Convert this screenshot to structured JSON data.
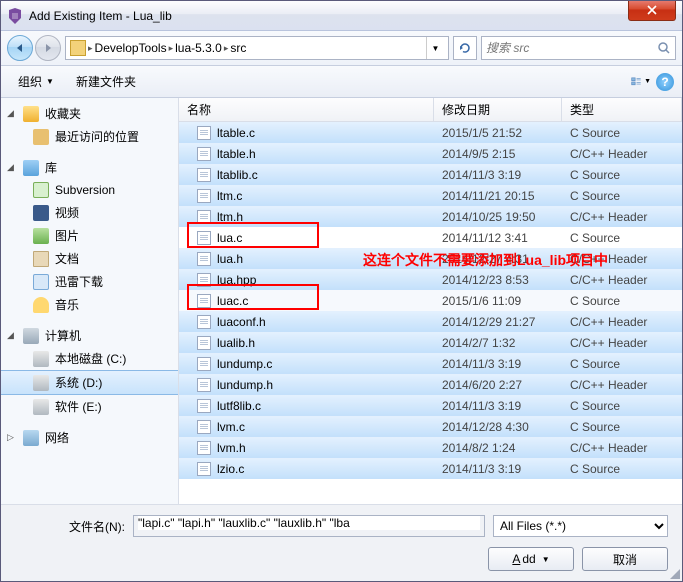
{
  "title": "Add Existing Item - Lua_lib",
  "breadcrumb": {
    "p1": "DevelopTools",
    "p2": "lua-5.3.0",
    "p3": "src"
  },
  "search": {
    "placeholder": "搜索 src"
  },
  "toolbar": {
    "organize": "组织",
    "newfolder": "新建文件夹"
  },
  "sidebar": {
    "fav": "收藏夹",
    "recent": "最近访问的位置",
    "lib": "库",
    "svn": "Subversion",
    "video": "视频",
    "image": "图片",
    "doc": "文档",
    "dl": "迅雷下载",
    "music": "音乐",
    "pc": "计算机",
    "c": "本地磁盘 (C:)",
    "d": "系统 (D:)",
    "e": "软件 (E:)",
    "net": "网络"
  },
  "cols": {
    "name": "名称",
    "date": "修改日期",
    "type": "类型"
  },
  "files": {
    "r0": {
      "n": "ltable.c",
      "d": "2015/1/5 21:52",
      "t": "C Source"
    },
    "r1": {
      "n": "ltable.h",
      "d": "2014/9/5 2:15",
      "t": "C/C++ Header"
    },
    "r2": {
      "n": "ltablib.c",
      "d": "2014/11/3 3:19",
      "t": "C Source"
    },
    "r3": {
      "n": "ltm.c",
      "d": "2014/11/21 20:15",
      "t": "C Source"
    },
    "r4": {
      "n": "ltm.h",
      "d": "2014/10/25 19:50",
      "t": "C/C++ Header"
    },
    "r5": {
      "n": "lua.c",
      "d": "2014/11/12 3:41",
      "t": "C Source"
    },
    "r6": {
      "n": "lua.h",
      "d": "2014/12/27 4:31",
      "t": "C/C++ Header"
    },
    "r7": {
      "n": "lua.hpp",
      "d": "2014/12/23 8:53",
      "t": "C/C++ Header"
    },
    "r8": {
      "n": "luac.c",
      "d": "2015/1/6 11:09",
      "t": "C Source"
    },
    "r9": {
      "n": "luaconf.h",
      "d": "2014/12/29 21:27",
      "t": "C/C++ Header"
    },
    "r10": {
      "n": "lualib.h",
      "d": "2014/2/7 1:32",
      "t": "C/C++ Header"
    },
    "r11": {
      "n": "lundump.c",
      "d": "2014/11/3 3:19",
      "t": "C Source"
    },
    "r12": {
      "n": "lundump.h",
      "d": "2014/6/20 2:27",
      "t": "C/C++ Header"
    },
    "r13": {
      "n": "lutf8lib.c",
      "d": "2014/11/3 3:19",
      "t": "C Source"
    },
    "r14": {
      "n": "lvm.c",
      "d": "2014/12/28 4:30",
      "t": "C Source"
    },
    "r15": {
      "n": "lvm.h",
      "d": "2014/8/2 1:24",
      "t": "C/C++ Header"
    },
    "r16": {
      "n": "lzio.c",
      "d": "2014/11/3 3:19",
      "t": "C Source"
    }
  },
  "annotation": "这连个文件不需要添加到Lua_lib项目中",
  "bottom": {
    "filename_label": "文件名(N):",
    "filename_value": "\"lapi.c\" \"lapi.h\" \"lauxlib.c\" \"lauxlib.h\" \"lba",
    "filter": "All Files (*.*)",
    "add": "Add",
    "cancel": "取消"
  }
}
